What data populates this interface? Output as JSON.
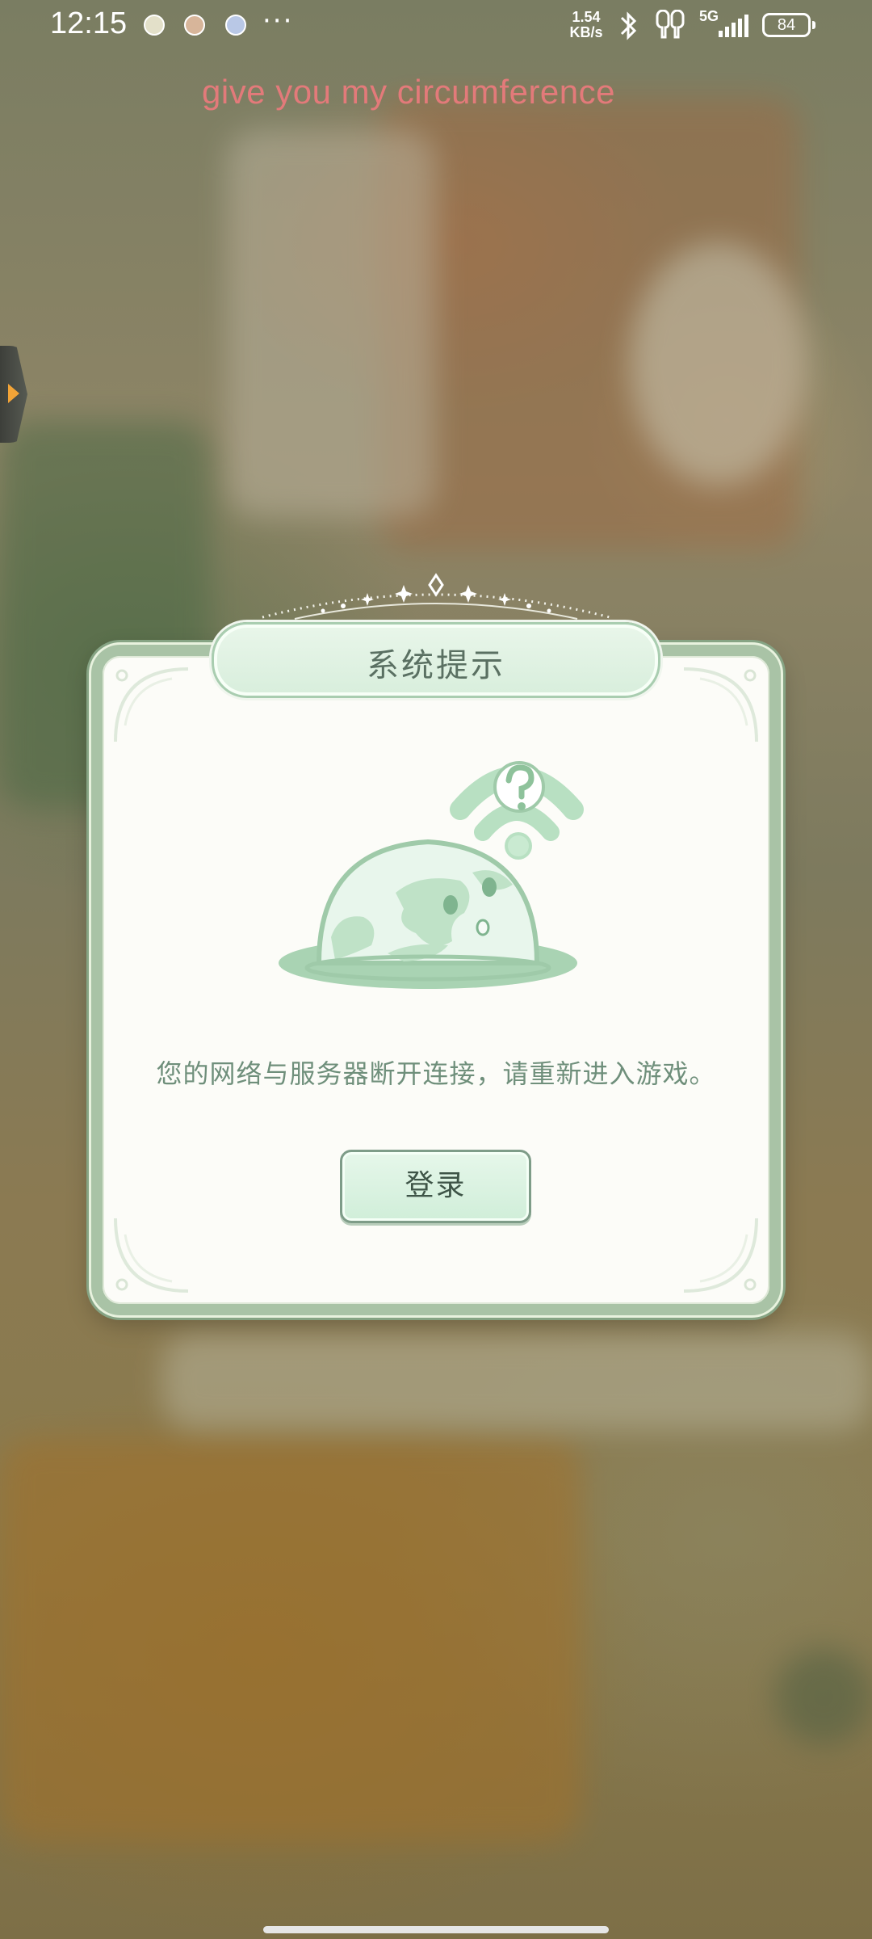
{
  "status_bar": {
    "time": "12:15",
    "more": "···",
    "net_speed_value": "1.54",
    "net_speed_unit": "KB/s",
    "signal_label": "5G",
    "battery": "84"
  },
  "lyric": {
    "text": "give you my circumference"
  },
  "dialog": {
    "title": "系统提示",
    "message": "您的网络与服务器断开连接，请重新进入游戏。",
    "button_label": "登录",
    "illustration_icon": "disconnected-globe-wifi-question-icon"
  },
  "colors": {
    "dialog_border": "#a9c3a6",
    "title_text": "#5a7062",
    "message_text": "#6f8f7b",
    "button_fill": "#d8f0df",
    "lyric_text": "#e37a7a"
  }
}
